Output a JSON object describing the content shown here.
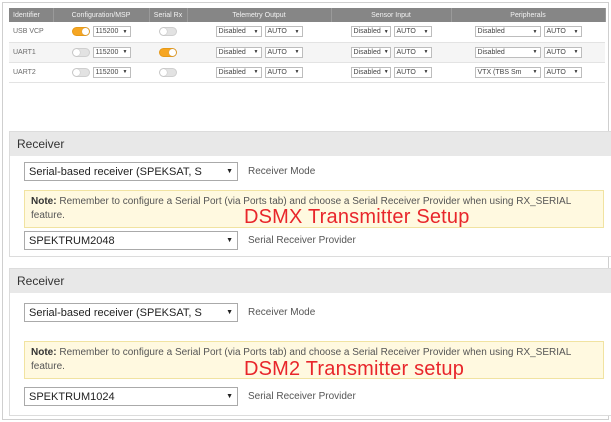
{
  "ports": {
    "headers": [
      "Identifier",
      "Configuration/MSP",
      "Serial Rx",
      "Telemetry Output",
      "Sensor Input",
      "Peripherals"
    ],
    "rows": [
      {
        "id": "USB VCP",
        "msp_on": true,
        "msp_baud": "115200",
        "rx_on": false,
        "telem": "Disabled",
        "telem_baud": "AUTO",
        "sensor": "Disabled",
        "sensor_baud": "AUTO",
        "periph": "Disabled",
        "periph_baud": "AUTO"
      },
      {
        "id": "UART1",
        "msp_on": false,
        "msp_baud": "115200",
        "rx_on": true,
        "telem": "Disabled",
        "telem_baud": "AUTO",
        "sensor": "Disabled",
        "sensor_baud": "AUTO",
        "periph": "Disabled",
        "periph_baud": "AUTO"
      },
      {
        "id": "UART2",
        "msp_on": false,
        "msp_baud": "115200",
        "rx_on": false,
        "telem": "Disabled",
        "telem_baud": "AUTO",
        "sensor": "Disabled",
        "sensor_baud": "AUTO",
        "periph": "VTX (TBS Sm",
        "periph_baud": "AUTO"
      }
    ]
  },
  "receivers": [
    {
      "title": "Receiver",
      "mode_value": "Serial-based receiver (SPEKSAT, S",
      "mode_label": "Receiver Mode",
      "note_bold": "Note:",
      "note_text": " Remember to configure a Serial Port (via Ports tab) and choose a Serial Receiver Provider when using RX_SERIAL feature.",
      "overlay": "DSMX Transmitter Setup",
      "provider_value": "SPEKTRUM2048",
      "provider_label": "Serial Receiver Provider"
    },
    {
      "title": "Receiver",
      "mode_value": "Serial-based receiver (SPEKSAT, S",
      "mode_label": "Receiver Mode",
      "note_bold": "Note:",
      "note_text": " Remember to configure a Serial Port (via Ports tab) and choose a Serial Receiver Provider when using RX_SERIAL feature.",
      "overlay": "DSM2 Transmitter setup",
      "provider_value": "SPEKTRUM1024",
      "provider_label": "Serial Receiver Provider"
    }
  ],
  "colors": {
    "toggle_on": "#f6a623",
    "overlay_text": "#e8262b",
    "note_bg": "#fff9e0",
    "header_bg": "#868686"
  },
  "icons": {
    "dropdown": "chevron-down-icon",
    "toggle": "toggle-switch"
  }
}
